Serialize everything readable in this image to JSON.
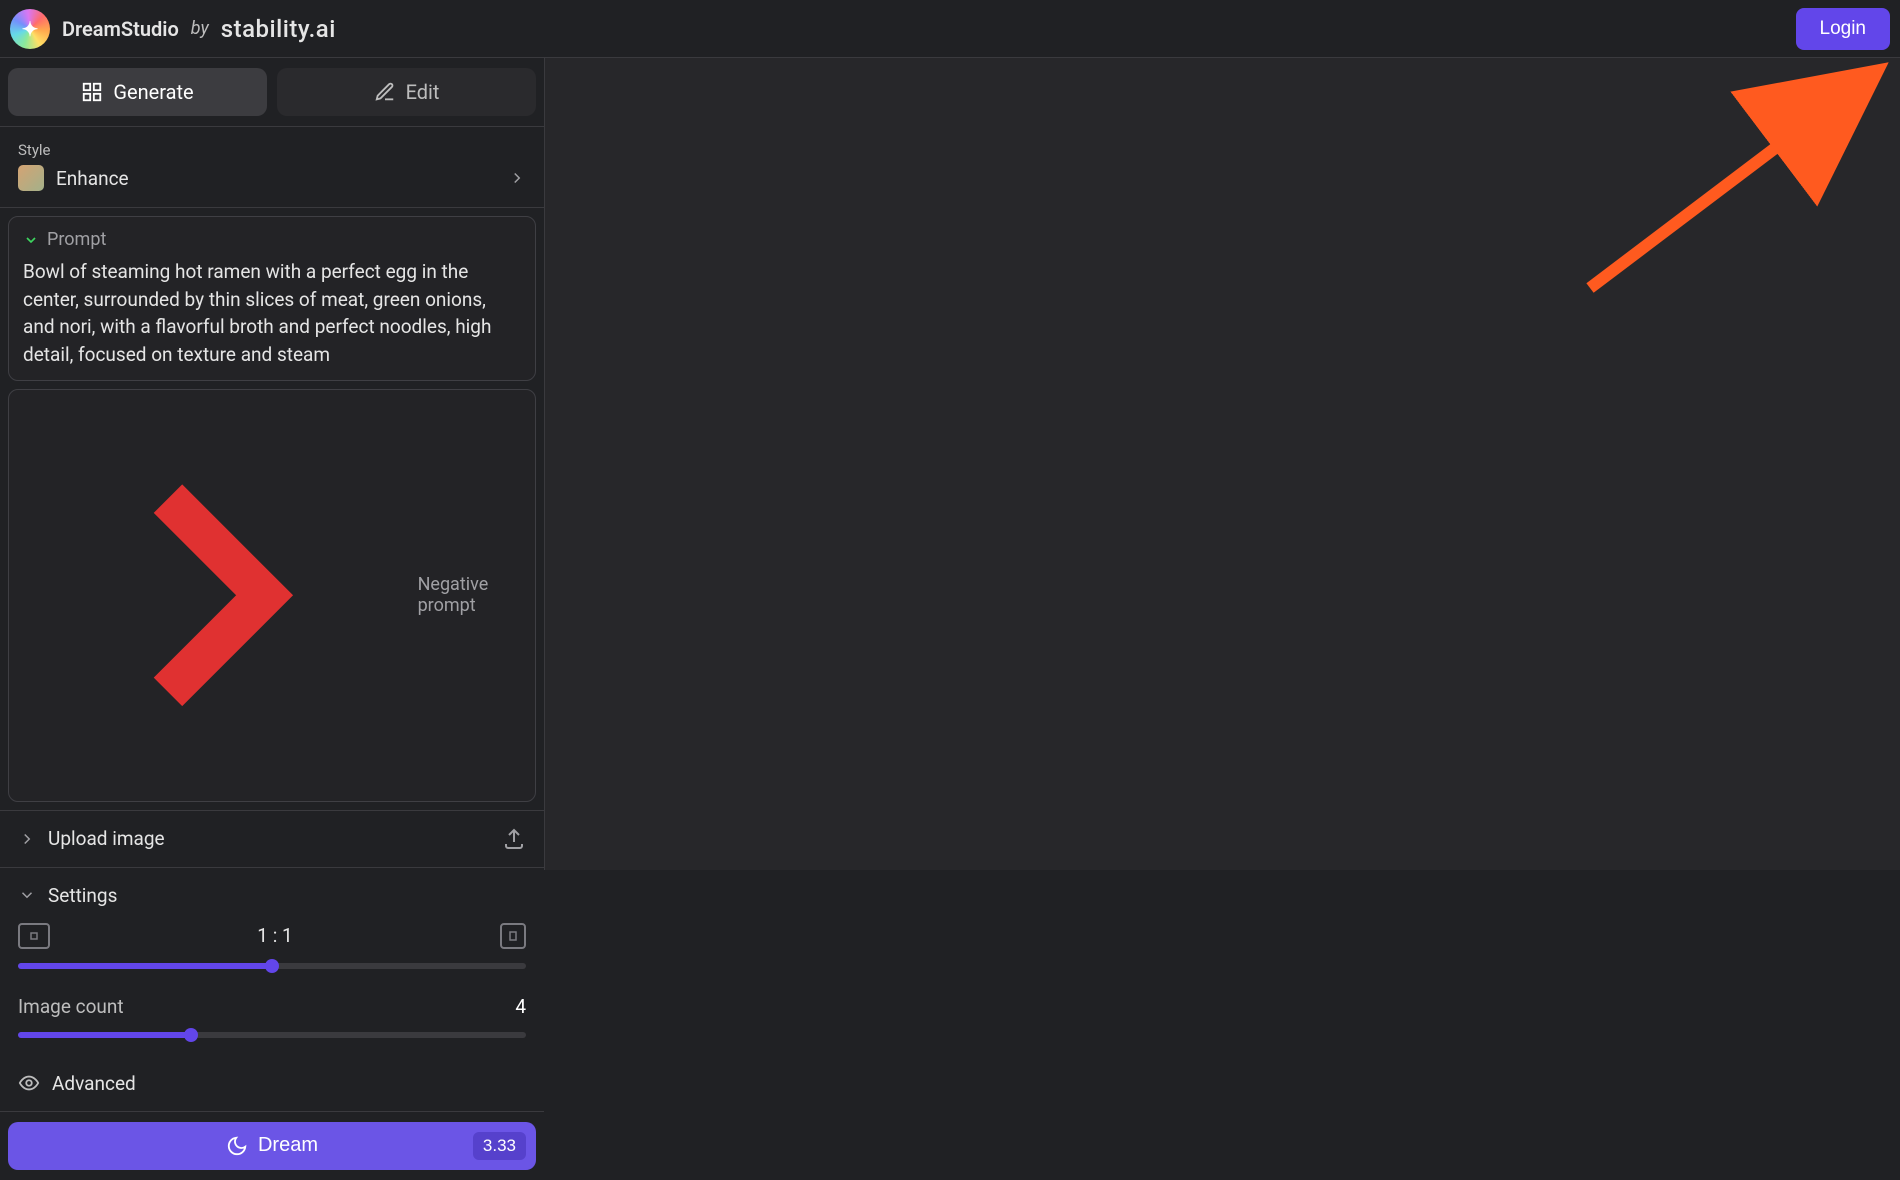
{
  "header": {
    "brand_name": "DreamStudio",
    "brand_by": "by",
    "brand_stability": "stability.ai",
    "login_label": "Login"
  },
  "tabs": {
    "generate_label": "Generate",
    "edit_label": "Edit"
  },
  "style": {
    "section_label": "Style",
    "selected": "Enhance"
  },
  "prompt": {
    "title": "Prompt",
    "text": "Bowl of steaming hot ramen with a perfect egg in the center, surrounded by thin slices of meat, green onions, and nori, with a flavorful broth and perfect noodles, high detail, focused on texture and steam",
    "negative_title": "Negative prompt"
  },
  "upload": {
    "label": "Upload image"
  },
  "settings": {
    "label": "Settings",
    "aspect_ratio": "1 : 1",
    "aspect_slider_pct": 50,
    "image_count_label": "Image count",
    "image_count_value": "4",
    "image_count_slider_pct": 34,
    "advanced_label": "Advanced"
  },
  "dream": {
    "label": "Dream",
    "cost": "3.33"
  },
  "colors": {
    "accent": "#6246ea",
    "arrow": "#ff5a1f"
  }
}
